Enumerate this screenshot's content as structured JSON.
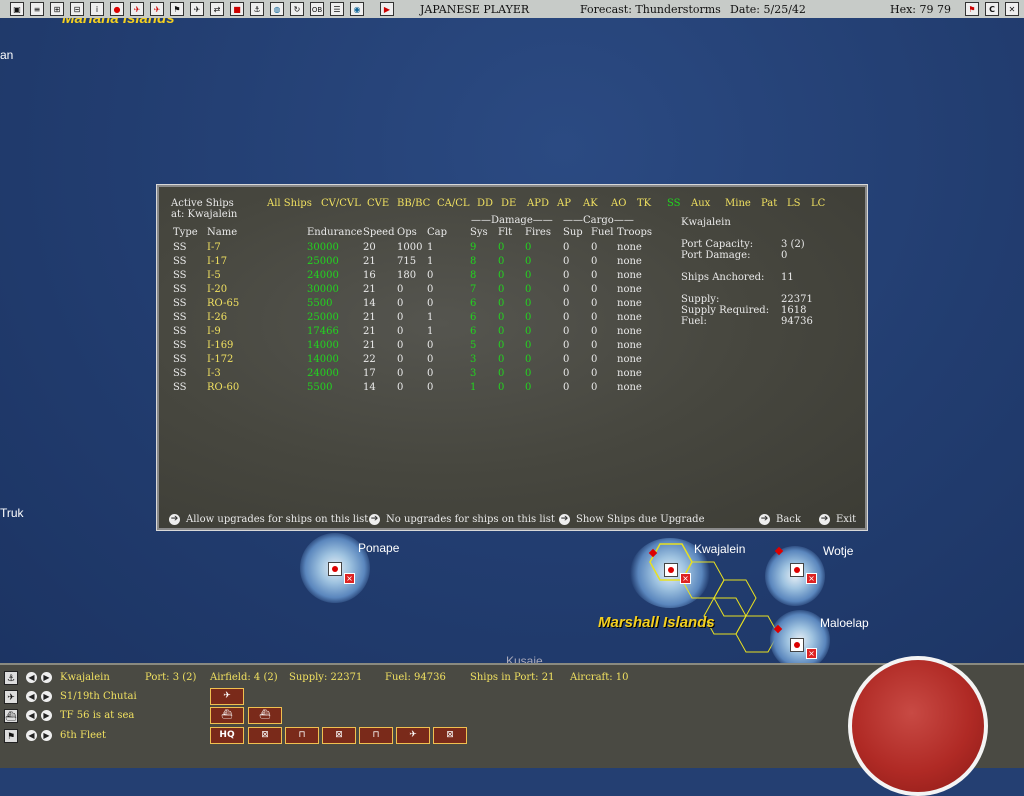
{
  "toolbar": {
    "player": "JAPANESE PLAYER",
    "forecast": "Forecast: Thunderstorms",
    "date": "Date: 5/25/42",
    "hex": "Hex: 79 79",
    "right_icons": [
      "flag-icon",
      "c-icon",
      "close-icon"
    ]
  },
  "map": {
    "labels": {
      "top_left_partial": "Mariana Islands",
      "left_partial": "an",
      "truk": "Truk",
      "ponape": "Ponape",
      "kwajalein": "Kwajalein",
      "wotje": "Wotje",
      "maloelap": "Maloelap",
      "marshall": "Marshall Islands",
      "kusaie": "Kusaie"
    }
  },
  "dialog": {
    "title_line1": "Active Ships",
    "title_line2": "at: Kwajalein",
    "filters": [
      "All Ships",
      "CV/CVL",
      "CVE",
      "BB/BC",
      "CA/CL",
      "DD",
      "DE",
      "APD",
      "AP",
      "AK",
      "AO",
      "TK",
      "SS",
      "Aux",
      "Mine",
      "Pat",
      "LS",
      "LC"
    ],
    "active_filter": "SS",
    "group_headers": {
      "damage": "Damage",
      "cargo": "Cargo"
    },
    "columns": [
      "Type",
      "Name",
      "Endurance",
      "Speed",
      "Ops",
      "Cap",
      "Sys",
      "Flt",
      "Fires",
      "Sup",
      "Fuel",
      "Troops"
    ],
    "ships": [
      {
        "type": "SS",
        "name": "I-7",
        "endurance": "30000",
        "speed": "20",
        "ops": "1000",
        "cap": "1",
        "sys": "9",
        "flt": "0",
        "fires": "0",
        "sup": "0",
        "fuel": "0",
        "troops": "none"
      },
      {
        "type": "SS",
        "name": "I-17",
        "endurance": "25000",
        "speed": "21",
        "ops": "715",
        "cap": "1",
        "sys": "8",
        "flt": "0",
        "fires": "0",
        "sup": "0",
        "fuel": "0",
        "troops": "none"
      },
      {
        "type": "SS",
        "name": "I-5",
        "endurance": "24000",
        "speed": "16",
        "ops": "180",
        "cap": "0",
        "sys": "8",
        "flt": "0",
        "fires": "0",
        "sup": "0",
        "fuel": "0",
        "troops": "none"
      },
      {
        "type": "SS",
        "name": "I-20",
        "endurance": "30000",
        "speed": "21",
        "ops": "0",
        "cap": "0",
        "sys": "7",
        "flt": "0",
        "fires": "0",
        "sup": "0",
        "fuel": "0",
        "troops": "none"
      },
      {
        "type": "SS",
        "name": "RO-65",
        "endurance": "5500",
        "speed": "14",
        "ops": "0",
        "cap": "0",
        "sys": "6",
        "flt": "0",
        "fires": "0",
        "sup": "0",
        "fuel": "0",
        "troops": "none"
      },
      {
        "type": "SS",
        "name": "I-26",
        "endurance": "25000",
        "speed": "21",
        "ops": "0",
        "cap": "1",
        "sys": "6",
        "flt": "0",
        "fires": "0",
        "sup": "0",
        "fuel": "0",
        "troops": "none"
      },
      {
        "type": "SS",
        "name": "I-9",
        "endurance": "17466",
        "speed": "21",
        "ops": "0",
        "cap": "1",
        "sys": "6",
        "flt": "0",
        "fires": "0",
        "sup": "0",
        "fuel": "0",
        "troops": "none"
      },
      {
        "type": "SS",
        "name": "I-169",
        "endurance": "14000",
        "speed": "21",
        "ops": "0",
        "cap": "0",
        "sys": "5",
        "flt": "0",
        "fires": "0",
        "sup": "0",
        "fuel": "0",
        "troops": "none"
      },
      {
        "type": "SS",
        "name": "I-172",
        "endurance": "14000",
        "speed": "22",
        "ops": "0",
        "cap": "0",
        "sys": "3",
        "flt": "0",
        "fires": "0",
        "sup": "0",
        "fuel": "0",
        "troops": "none"
      },
      {
        "type": "SS",
        "name": "I-3",
        "endurance": "24000",
        "speed": "17",
        "ops": "0",
        "cap": "0",
        "sys": "3",
        "flt": "0",
        "fires": "0",
        "sup": "0",
        "fuel": "0",
        "troops": "none"
      },
      {
        "type": "SS",
        "name": "RO-60",
        "endurance": "5500",
        "speed": "14",
        "ops": "0",
        "cap": "0",
        "sys": "1",
        "flt": "0",
        "fires": "0",
        "sup": "0",
        "fuel": "0",
        "troops": "none"
      }
    ],
    "port_info": {
      "name": "Kwajalein",
      "port_capacity_label": "Port Capacity:",
      "port_capacity": "3 (2)",
      "port_damage_label": "Port Damage:",
      "port_damage": "0",
      "ships_anchored_label": "Ships Anchored:",
      "ships_anchored": "11",
      "supply_label": "Supply:",
      "supply": "22371",
      "supply_required_label": "Supply Required:",
      "supply_required": "1618",
      "fuel_label": "Fuel:",
      "fuel": "94736"
    },
    "buttons": {
      "allow_upgrades": "Allow upgrades for ships on this list",
      "no_upgrades": "No upgrades for ships on this list",
      "show_due": "Show Ships due Upgrade",
      "back": "Back",
      "exit": "Exit"
    }
  },
  "bottom": {
    "base_row": {
      "name": "Kwajalein",
      "port": "Port: 3 (2)",
      "airfield": "Airfield: 4 (2)",
      "supply": "Supply: 22371",
      "fuel": "Fuel: 94736",
      "ships_in_port": "Ships in Port: 21",
      "aircraft": "Aircraft: 10"
    },
    "air_row": {
      "name": "S1/19th Chutai"
    },
    "tf_row": {
      "name": "TF 56 is at sea"
    },
    "hq_row": {
      "name": "6th Fleet",
      "hq_label": "HQ"
    }
  },
  "colors": {
    "accent_green": "#22d41f",
    "accent_yellow": "#f0e060",
    "dialog_bg": "#47473f",
    "map_sea": "#243f72"
  }
}
